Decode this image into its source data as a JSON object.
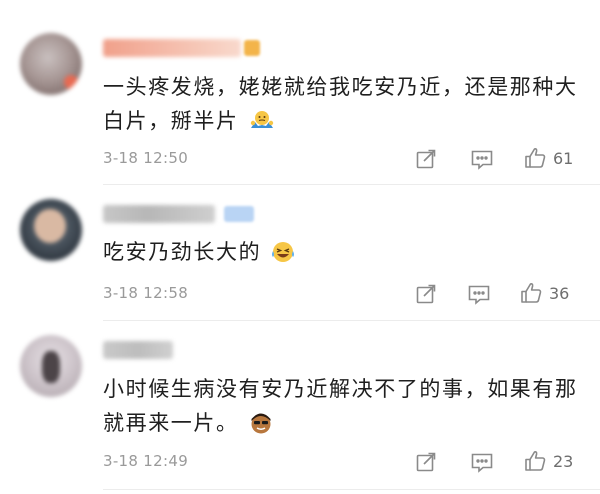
{
  "comments": [
    {
      "text": "一头疼发烧，姥姥就给我吃安乃近，还是那种大白片，掰半片",
      "time": "3-18 12:50",
      "likes": "61",
      "emoji": "shrug-emoji"
    },
    {
      "text": "吃安乃劲长大的",
      "time": "3-18 12:58",
      "likes": "36",
      "emoji": "laughing-crying-emoji"
    },
    {
      "text": "小时候生病没有安乃近解决不了的事，如果有那就再来一片。",
      "time": "3-18 12:49",
      "likes": "23",
      "emoji": "cool-face-emoji"
    }
  ],
  "colors": {
    "text": "#1f1f1f",
    "meta": "#9a9a9a",
    "icon": "#8a8a8a",
    "divider": "#ececec"
  }
}
